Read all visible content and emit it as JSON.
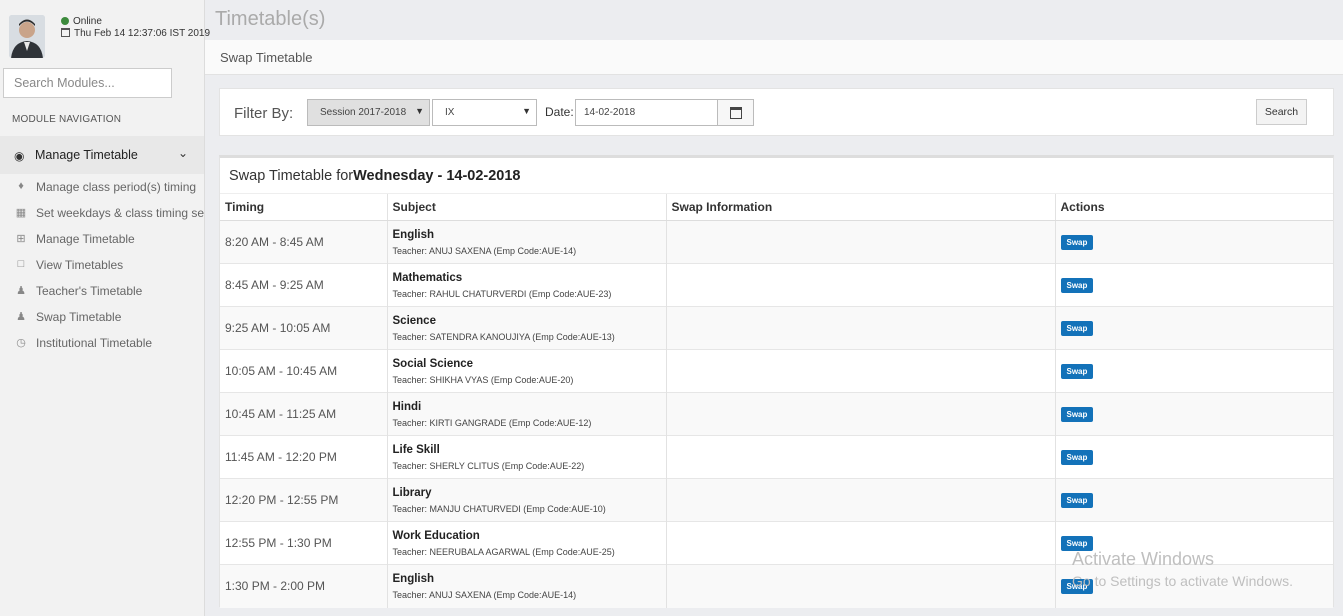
{
  "user": {
    "status": "Online",
    "datetime": "Thu Feb 14 12:37:06 IST 2019"
  },
  "sidebar": {
    "search_placeholder": "Search Modules...",
    "nav_heading": "MODULE NAVIGATION",
    "group_label": "Manage Timetable",
    "items": [
      {
        "label": "Manage class period(s) timing",
        "icon": "bell-icon"
      },
      {
        "label": "Set weekdays & class timing sets",
        "icon": "calendar-icon"
      },
      {
        "label": "Manage Timetable",
        "icon": "calendar-plus-icon"
      },
      {
        "label": "View Timetables",
        "icon": "calendar-icon"
      },
      {
        "label": "Teacher's Timetable",
        "icon": "user-icon"
      },
      {
        "label": "Swap Timetable",
        "icon": "user-icon"
      },
      {
        "label": "Institutional Timetable",
        "icon": "clock-icon"
      }
    ]
  },
  "header": {
    "title": "Timetable(s)",
    "breadcrumb": "Swap Timetable"
  },
  "filter": {
    "label": "Filter By:",
    "session": "Session 2017-2018",
    "class": "IX",
    "date_label": "Date:",
    "date_value": "14-02-2018",
    "search_label": "Search"
  },
  "table": {
    "caption_prefix": "Swap Timetable for",
    "caption_bold": "Wednesday - 14-02-2018",
    "columns": [
      "Timing",
      "Subject",
      "Swap Information",
      "Actions"
    ],
    "swap_label": "Swap",
    "rows": [
      {
        "timing": "8:20 AM - 8:45 AM",
        "subject": "English",
        "teacher": "Teacher: ANUJ SAXENA (Emp Code:AUE-14)"
      },
      {
        "timing": "8:45 AM - 9:25 AM",
        "subject": "Mathematics",
        "teacher": "Teacher: RAHUL CHATURVERDI (Emp Code:AUE-23)"
      },
      {
        "timing": "9:25 AM - 10:05 AM",
        "subject": "Science",
        "teacher": "Teacher: SATENDRA KANOUJIYA (Emp Code:AUE-13)"
      },
      {
        "timing": "10:05 AM - 10:45 AM",
        "subject": "Social Science",
        "teacher": "Teacher: SHIKHA VYAS (Emp Code:AUE-20)"
      },
      {
        "timing": "10:45 AM - 11:25 AM",
        "subject": "Hindi",
        "teacher": "Teacher: KIRTI GANGRADE (Emp Code:AUE-12)"
      },
      {
        "timing": "11:45 AM - 12:20 PM",
        "subject": "Life Skill",
        "teacher": "Teacher: SHERLY CLITUS (Emp Code:AUE-22)"
      },
      {
        "timing": "12:20 PM - 12:55 PM",
        "subject": "Library",
        "teacher": "Teacher: MANJU CHATURVEDI (Emp Code:AUE-10)"
      },
      {
        "timing": "12:55 PM - 1:30 PM",
        "subject": "Work Education",
        "teacher": "Teacher: NEERUBALA AGARWAL (Emp Code:AUE-25)"
      },
      {
        "timing": "1:30 PM - 2:00 PM",
        "subject": "English",
        "teacher": "Teacher: ANUJ SAXENA (Emp Code:AUE-14)"
      }
    ]
  },
  "watermark": {
    "line1": "Activate Windows",
    "line2": "Go to Settings to activate Windows."
  }
}
